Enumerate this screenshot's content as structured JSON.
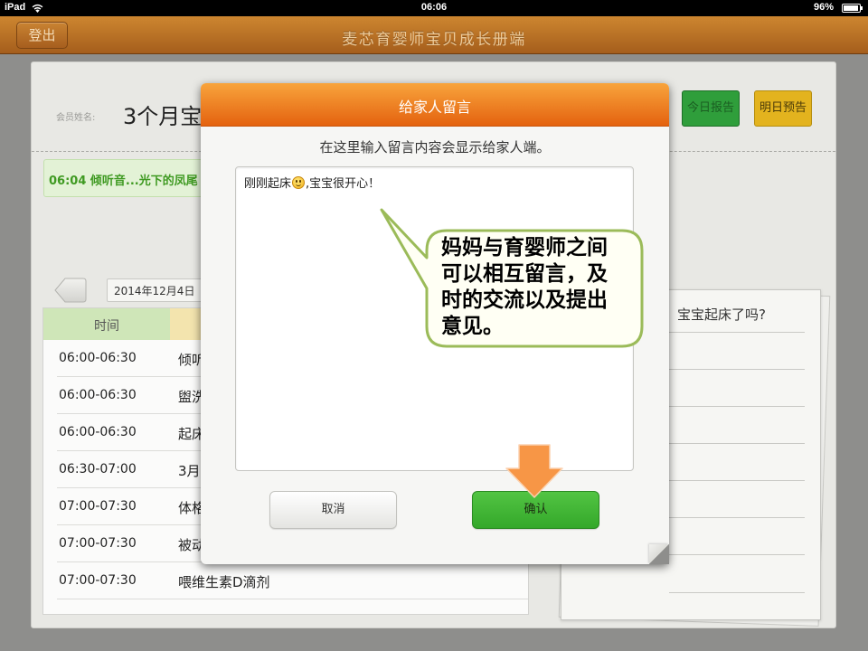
{
  "status_bar": {
    "device": "iPad",
    "time": "06:06",
    "battery": "96%",
    "battery_fraction": 0.96
  },
  "header": {
    "logout_label": "登出",
    "title": "麦芯育婴师宝贝成长册端"
  },
  "member": {
    "label": "会员姓名:",
    "name": "3个月宝"
  },
  "actions": {
    "today_report_label": "今日报告",
    "tomorrow_preview_label": "明日预告"
  },
  "notice": {
    "text": "06:04 倾听音...光下的凤尾"
  },
  "date_selector": {
    "date": "2014年12月4日"
  },
  "schedule": {
    "time_header": "时间",
    "rows": [
      {
        "time": "06:00-06:30",
        "activity": "倾听"
      },
      {
        "time": "06:00-06:30",
        "activity": "盥洗"
      },
      {
        "time": "06:00-06:30",
        "activity": "起床"
      },
      {
        "time": "06:30-07:00",
        "activity": "3月"
      },
      {
        "time": "07:00-07:30",
        "activity": "体格"
      },
      {
        "time": "07:00-07:30",
        "activity": "被动"
      },
      {
        "time": "07:00-07:30",
        "activity": "喂维生素D滴剂"
      }
    ]
  },
  "notebook": {
    "visible_text": "，宝宝起床了吗?"
  },
  "modal": {
    "title": "给家人留言",
    "hint": "在这里输入留言内容会显示给家人端。",
    "message_before_emoji": "刚刚起床",
    "message_after_emoji": ",宝宝很开心！",
    "cancel_label": "取消",
    "confirm_label": "确认"
  },
  "callout": {
    "lines": [
      "妈妈与育婴师之间",
      "可以相互留言，及",
      "时的交流以及提出",
      "意见。"
    ]
  },
  "icons": {
    "status_wifi": "wifi-icon",
    "status_battery": "battery-icon",
    "date_prev": "arrow-left-icon",
    "message_emoji": "smiley-emoji-icon",
    "pointer": "arrow-down-icon"
  },
  "colors": {
    "status_bar": "#000000",
    "header_top": "#cd8630",
    "header_bottom": "#a55e1c",
    "modal_title_top": "#f8a43c",
    "modal_title_bottom": "#e4620f",
    "confirm_green": "#34a82a",
    "today_button_green": "#2f9e3b",
    "tomorrow_button_yellow": "#e3b31e",
    "notice_text_green": "#3f9a22",
    "callout_border": "#9bbb59",
    "callout_fill": "#fffff4",
    "arrow_orange": "#f79646"
  }
}
